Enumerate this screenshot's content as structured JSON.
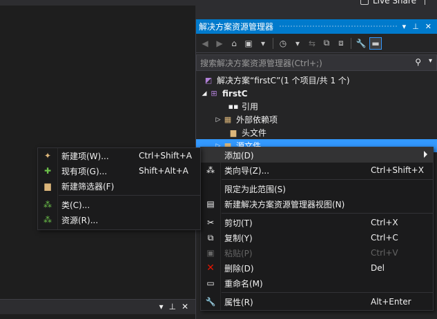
{
  "topbar": {
    "live_share": "Live Share"
  },
  "bottom_panel": {
    "pin": "▼ ⊥ ✕"
  },
  "solution_explorer": {
    "title": "解决方案资源管理器",
    "title_buttons": [
      "▾",
      "⊥",
      "✕"
    ],
    "search_placeholder": "搜索解决方案资源管理器(Ctrl+;)",
    "tree": [
      {
        "label": "解决方案“firstC”(1 个项目/共 1 个)",
        "icon": "solution-icon"
      },
      {
        "label": "firstC",
        "icon": "project-icon",
        "bold": true
      },
      {
        "label": "引用",
        "icon": "references-icon"
      },
      {
        "label": "外部依赖项",
        "icon": "external-deps-icon"
      },
      {
        "label": "头文件",
        "icon": "folder-icon"
      },
      {
        "label": "源文件",
        "icon": "folder-icon"
      }
    ]
  },
  "main_menu": {
    "items": [
      {
        "label": "添加(D)",
        "shortcut": "",
        "icon": "",
        "submenu": true
      },
      {
        "label": "类向导(Z)...",
        "shortcut": "Ctrl+Shift+X",
        "icon": "class-wizard-icon"
      },
      {
        "label": "限定为此范围(S)",
        "shortcut": "",
        "icon": ""
      },
      {
        "label": "新建解决方案资源管理器视图(N)",
        "shortcut": "",
        "icon": "new-view-icon"
      },
      {
        "label": "剪切(T)",
        "shortcut": "Ctrl+X",
        "icon": "cut-icon"
      },
      {
        "label": "复制(Y)",
        "shortcut": "Ctrl+C",
        "icon": "copy-icon"
      },
      {
        "label": "粘贴(P)",
        "shortcut": "Ctrl+V",
        "icon": "paste-icon",
        "disabled": true
      },
      {
        "label": "删除(D)",
        "shortcut": "Del",
        "icon": "delete-icon"
      },
      {
        "label": "重命名(M)",
        "shortcut": "",
        "icon": "rename-icon"
      },
      {
        "label": "属性(R)",
        "shortcut": "Alt+Enter",
        "icon": "properties-icon"
      }
    ]
  },
  "sub_menu": {
    "items": [
      {
        "label": "新建项(W)...",
        "shortcut": "Ctrl+Shift+A",
        "icon": "new-item-icon"
      },
      {
        "label": "现有项(G)...",
        "shortcut": "Shift+Alt+A",
        "icon": "existing-item-icon"
      },
      {
        "label": "新建筛选器(F)",
        "shortcut": "",
        "icon": "new-filter-icon"
      },
      {
        "label": "类(C)...",
        "shortcut": "",
        "icon": "class-icon"
      },
      {
        "label": "资源(R)...",
        "shortcut": "",
        "icon": "resource-icon"
      }
    ]
  },
  "colors": {
    "accent": "#007acc",
    "selection": "#3399ff",
    "delete_icon": "#e51400"
  }
}
